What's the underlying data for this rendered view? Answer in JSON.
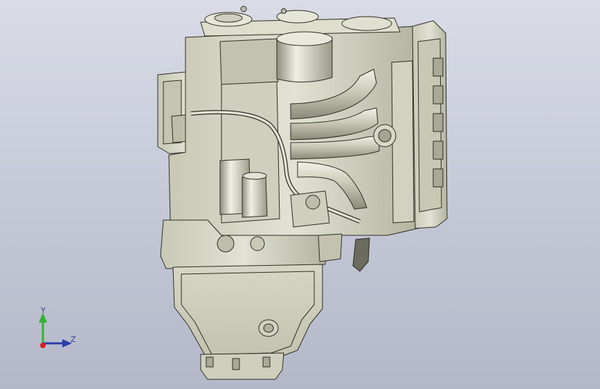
{
  "viewport": {
    "background_top": "#d9dce6",
    "background_bottom": "#b3b7c8"
  },
  "model": {
    "body_fill": "#d8d8c6",
    "body_shade": "#b9b9a6",
    "highlight": "#ecece0",
    "edge_color": "#2a2a22"
  },
  "triad": {
    "y_label": "Y",
    "z_label": "Z",
    "y_color": "#2fb52f",
    "z_color": "#2d3ea8",
    "x_color": "#d82020"
  }
}
